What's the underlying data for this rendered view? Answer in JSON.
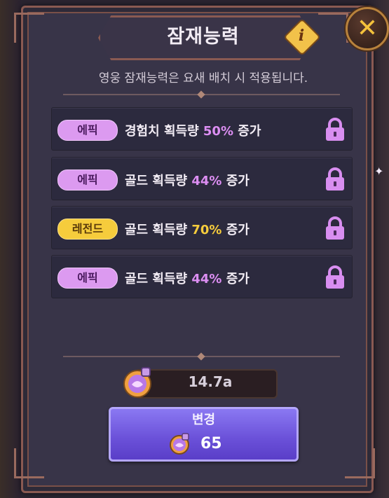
{
  "header": {
    "title": "잠재능력",
    "info_icon": "info-icon",
    "close_icon": "close-icon"
  },
  "subtitle": "영웅 잠재능력은 요새 배치 시 적용됩니다.",
  "abilities": [
    {
      "rarity": "에픽",
      "rarity_type": "epic",
      "prefix": "경험치 획득량 ",
      "value": "50%",
      "suffix": " 증가",
      "locked": true
    },
    {
      "rarity": "에픽",
      "rarity_type": "epic",
      "prefix": "골드 획득량 ",
      "value": "44%",
      "suffix": " 증가",
      "locked": true
    },
    {
      "rarity": "레전드",
      "rarity_type": "legend",
      "prefix": "골드 획득량 ",
      "value": "70%",
      "suffix": " 증가",
      "locked": true
    },
    {
      "rarity": "에픽",
      "rarity_type": "epic",
      "prefix": "골드 획득량 ",
      "value": "44%",
      "suffix": " 증가",
      "locked": true
    }
  ],
  "currency": {
    "icon": "potion-orb-icon",
    "amount": "14.7a"
  },
  "change_button": {
    "label": "변경",
    "cost": "65",
    "cost_icon": "potion-orb-icon"
  },
  "colors": {
    "epic": "#dc9af0",
    "legend": "#f6cc3c",
    "lock": "#d88ef0",
    "button": "#6a50d8"
  }
}
